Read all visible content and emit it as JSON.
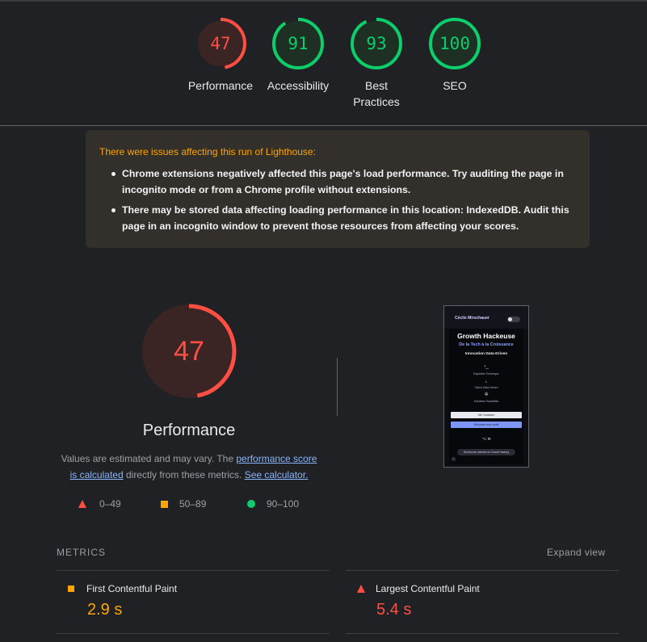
{
  "gauges": [
    {
      "score": "47",
      "label": "Performance",
      "value": 47,
      "color": "#ff4e42",
      "bg": "#3a2524"
    },
    {
      "score": "91",
      "label": "Accessibility",
      "value": 91,
      "color": "#0cce6b",
      "bg": "#1e3024"
    },
    {
      "score": "93",
      "label": "Best Practices",
      "value": 93,
      "color": "#0cce6b",
      "bg": "#1e3024"
    },
    {
      "score": "100",
      "label": "SEO",
      "value": 100,
      "color": "#0cce6b",
      "bg": "#1e3024"
    }
  ],
  "warning": {
    "title": "There were issues affecting this run of Lighthouse:",
    "items": [
      "Chrome extensions negatively affected this page's load performance. Try auditing the page in incognito mode or from a Chrome profile without extensions.",
      "There may be stored data affecting loading performance in this location: IndexedDB. Audit this page in an incognito window to prevent those resources from affecting your scores."
    ]
  },
  "performance": {
    "score": "47",
    "value": 47,
    "title": "Performance",
    "desc_prefix": "Values are estimated and may vary. The ",
    "desc_link1": "performance score is calculated",
    "desc_middle": " directly from these metrics. ",
    "desc_link2": "See calculator."
  },
  "legend": {
    "fail": "0–49",
    "average": "50–89",
    "pass": "90–100"
  },
  "thumbnail": {
    "name": "Cécile Mirschauer",
    "title": "Growth Hackeuse",
    "subtitle": "De la Tech à la Croissance",
    "tagline": "Innovation Data-Driven",
    "features": [
      "Expertise Technique",
      "Vision Data-Driven",
      "Solutions Scalables"
    ],
    "button1": "Me Contacter",
    "button2": "Découvrir mon profil",
    "social": "⌥ in",
    "pill": "Rechercher attentat ne Growth Hacking"
  },
  "metrics": {
    "title": "METRICS",
    "expand": "Expand view",
    "items": [
      {
        "name": "First Contentful Paint",
        "value": "2.9 s",
        "status": "average",
        "color": "#ffa400"
      },
      {
        "name": "Largest Contentful Paint",
        "value": "5.4 s",
        "status": "fail",
        "color": "#ff4e42"
      }
    ]
  },
  "colors": {
    "fail": "#ff4e42",
    "average": "#ffa400",
    "pass": "#0cce6b",
    "link": "#8ab4f8"
  }
}
